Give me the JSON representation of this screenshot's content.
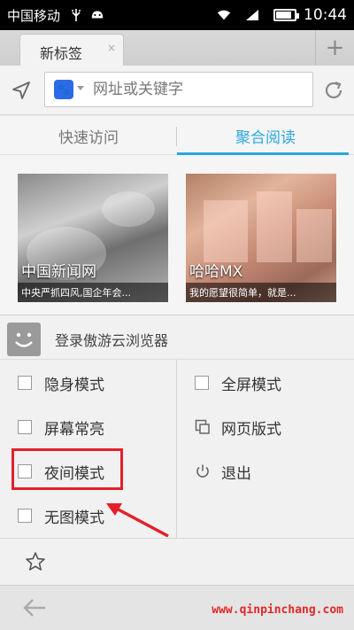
{
  "status_bar": {
    "carrier": "中国移动",
    "time": "10:44",
    "battery_level": 0.85
  },
  "tab": {
    "title": "新标签",
    "close_glyph": "×",
    "new_tab_glyph": "+"
  },
  "url_bar": {
    "placeholder": "网址或关键字",
    "search_engine_icon": "baidu-paw-icon",
    "engine_glyph": "🐾"
  },
  "content_tabs": [
    {
      "label": "快速访问",
      "active": false
    },
    {
      "label": "聚合阅读",
      "active": true
    }
  ],
  "cards": [
    {
      "title": "中国新闻网",
      "subtitle": "中央严抓四风,国企年会..."
    },
    {
      "title": "哈哈MX",
      "subtitle": "我的愿望很简单，就是..."
    }
  ],
  "menu": {
    "login_label": "登录傲游云浏览器",
    "left_items": [
      {
        "label": "隐身模式",
        "icon": "checkbox"
      },
      {
        "label": "屏幕常亮",
        "icon": "checkbox"
      },
      {
        "label": "夜间模式",
        "icon": "checkbox"
      },
      {
        "label": "无图模式",
        "icon": "checkbox"
      }
    ],
    "right_items": [
      {
        "label": "全屏模式",
        "icon": "checkbox"
      },
      {
        "label": "网页版式",
        "icon": "layout-icon"
      },
      {
        "label": "退出",
        "icon": "power-icon"
      }
    ]
  },
  "watermark": "www.qinpinchang.com",
  "colors": {
    "accent": "#2aa6dc",
    "highlight": "#e3202a"
  }
}
